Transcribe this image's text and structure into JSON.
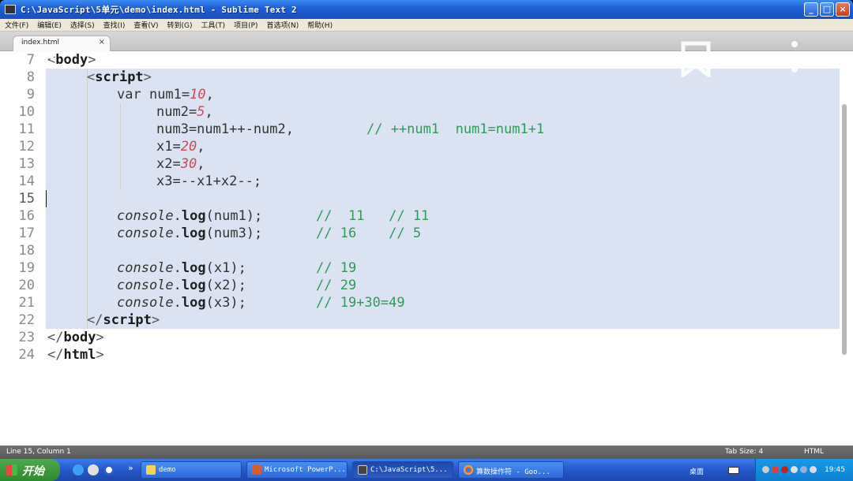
{
  "window": {
    "title": "C:\\JavaScript\\5单元\\demo\\index.html - Sublime Text 2",
    "buttons": [
      "_",
      "□",
      "×"
    ]
  },
  "menu": [
    "文件(F)",
    "编辑(E)",
    "选择(S)",
    "查找(I)",
    "查看(V)",
    "转到(G)",
    "工具(T)",
    "项目(P)",
    "首选项(N)",
    "帮助(H)"
  ],
  "tab": {
    "label": "index.html",
    "close": "×"
  },
  "overlay_icons": [
    "back-icon",
    "bookmark-icon",
    "more-icon"
  ],
  "editor": {
    "lines": [
      {
        "n": "7"
      },
      {
        "n": "8"
      },
      {
        "n": "9"
      },
      {
        "n": "10"
      },
      {
        "n": "11"
      },
      {
        "n": "12"
      },
      {
        "n": "13"
      },
      {
        "n": "14"
      },
      {
        "n": "15"
      },
      {
        "n": "16"
      },
      {
        "n": "17"
      },
      {
        "n": "18"
      },
      {
        "n": "19"
      },
      {
        "n": "20"
      },
      {
        "n": "21"
      },
      {
        "n": "22"
      },
      {
        "n": "23"
      },
      {
        "n": "24"
      }
    ],
    "code": {
      "l7": {
        "open": "<",
        "name": "body",
        "close": ">"
      },
      "l8": {
        "open": "<",
        "name": "script",
        "close": ">"
      },
      "l9": {
        "kw": "var ",
        "ident": "num1=",
        "num": "10",
        "end": ","
      },
      "l10": {
        "ident": "num2=",
        "num": "5",
        "end": ","
      },
      "l11": {
        "ident": "num3=num1++-num2,",
        "comment": "// ++num1  num1=num1+1"
      },
      "l12": {
        "ident": "x1=",
        "num": "20",
        "end": ","
      },
      "l13": {
        "ident": "x2=",
        "num": "30",
        "end": ","
      },
      "l14": {
        "ident": "x3=--x1+x2--;"
      },
      "l16": {
        "obj": "console",
        "dot": ".",
        "fn": "log",
        "args": "(num1);",
        "comment": "//  11   // 11"
      },
      "l17": {
        "obj": "console",
        "dot": ".",
        "fn": "log",
        "args": "(num3);",
        "comment": "// 16    // 5"
      },
      "l19": {
        "obj": "console",
        "dot": ".",
        "fn": "log",
        "args": "(x1);",
        "comment": "// 19"
      },
      "l20": {
        "obj": "console",
        "dot": ".",
        "fn": "log",
        "args": "(x2);",
        "comment": "// 29"
      },
      "l21": {
        "obj": "console",
        "dot": ".",
        "fn": "log",
        "args": "(x3);",
        "comment": "// 19+30=49"
      },
      "l22": {
        "open": "</",
        "name": "script",
        "close": ">"
      },
      "l23": {
        "open": "</",
        "name": "body",
        "close": ">"
      },
      "l24": {
        "open": "</",
        "name": "html",
        "close": ">"
      }
    },
    "colors": {
      "number": "#d04a5a",
      "comment": "#2e9b58",
      "selection": "#dbe3f2"
    }
  },
  "status": {
    "position": "Line 15, Column 1",
    "tab_size": "Tab Size: 4",
    "syntax": "HTML"
  },
  "taskbar": {
    "start": "开始",
    "chevron": "»",
    "items": [
      {
        "label": "demo"
      },
      {
        "label": "Microsoft PowerP..."
      },
      {
        "label": "C:\\JavaScript\\5..."
      },
      {
        "label": "算数操作符 - Goo..."
      }
    ],
    "desktop": "桌面",
    "clock": "19:45"
  }
}
